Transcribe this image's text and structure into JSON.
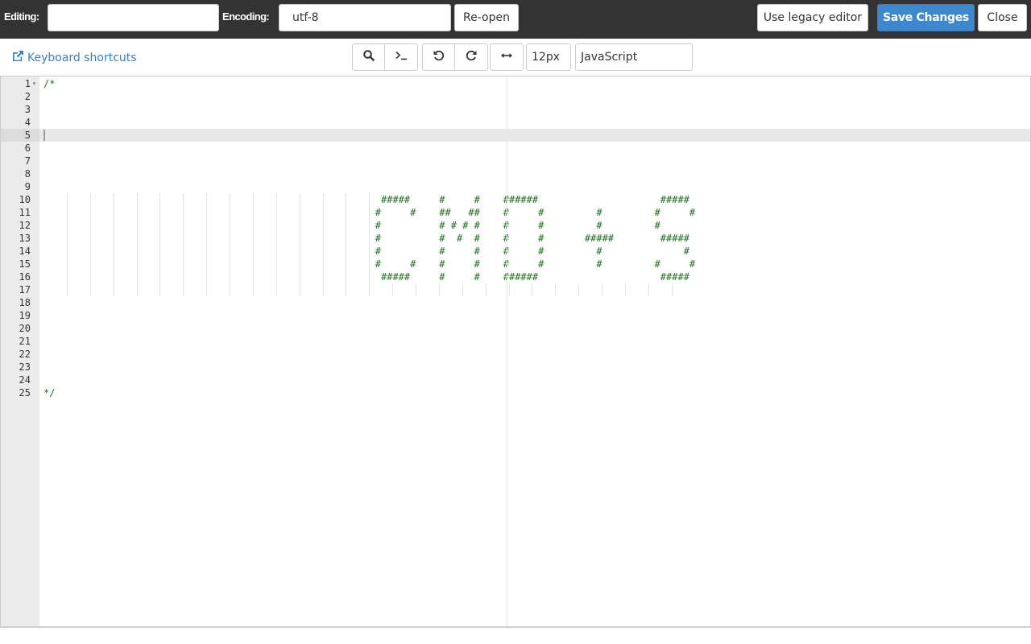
{
  "topbar": {
    "editing_label": "Editing:",
    "editing_value": "",
    "encoding_label": "Encoding:",
    "encoding_value": "utf-8",
    "reopen_label": "Re-open",
    "legacy_label": "Use legacy editor",
    "save_label": "Save Changes",
    "close_label": "Close",
    "accent_color": "#3d87cc"
  },
  "toolbar": {
    "shortcuts_label": "Keyboard shortcuts",
    "search_icon": "search-icon",
    "terminal_icon": "terminal-icon",
    "undo_icon": "undo-icon",
    "redo_icon": "redo-icon",
    "wrap_icon": "wrap-icon",
    "font_size": "12px",
    "language": "JavaScript"
  },
  "editor": {
    "active_line": 5,
    "comment_color": "#236e24",
    "lines": [
      "/*",
      "",
      "",
      "",
      "",
      "",
      "",
      "",
      "",
      "                                                          #####     #     #    ######                     #####",
      "                                                         #     #    ##   ##    #     #         #         #     #",
      "                                                         #          # # # #    #     #         #         #",
      "                                                         #          #  #  #    #     #       #####        #####",
      "                                                         #          #     #    #     #         #              #",
      "                                                         #     #    #     #    #     #         #         #     #",
      "                                                          #####     #     #    ######                     #####",
      "",
      "",
      "",
      "",
      "",
      "",
      "",
      "",
      "*/"
    ]
  }
}
